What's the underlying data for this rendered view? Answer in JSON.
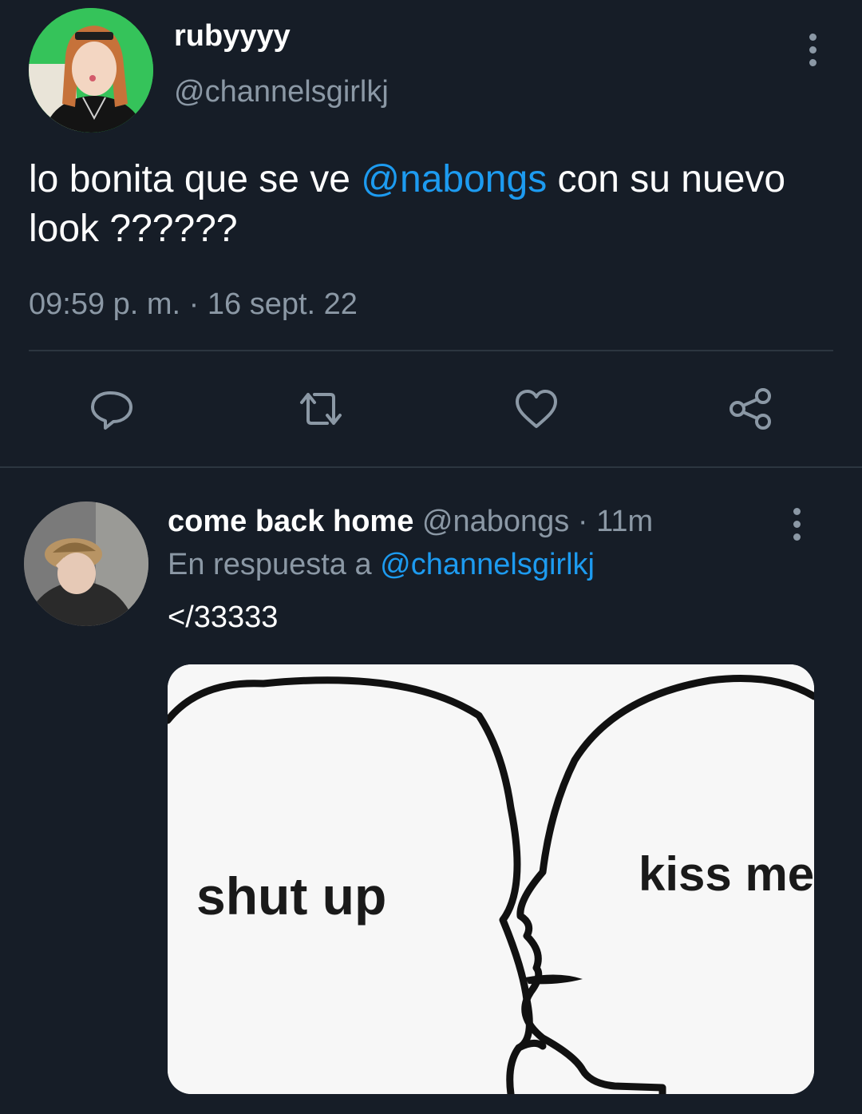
{
  "tweet": {
    "display_name": "rubyyyy",
    "handle": "@channelsgirlkj",
    "text_before": "lo bonita que se ve ",
    "mention": "@nabongs",
    "text_after": " con su nuevo look ??????",
    "timestamp": "09:59 p. m. · 16 sept. 22"
  },
  "actions": {
    "reply": "reply-icon",
    "retweet": "retweet-icon",
    "like": "heart-icon",
    "share": "share-icon"
  },
  "reply": {
    "display_name": "come back home",
    "handle": "@nabongs",
    "time": "· 11m",
    "reply_prefix": "En respuesta a",
    "reply_to": "@channelsgirlkj",
    "text": "</33333",
    "media": {
      "left_caption": "shut up",
      "right_caption": "kiss me"
    }
  },
  "colors": {
    "background": "#161d27",
    "accent": "#1d9bf0",
    "muted": "#8b98a5"
  }
}
